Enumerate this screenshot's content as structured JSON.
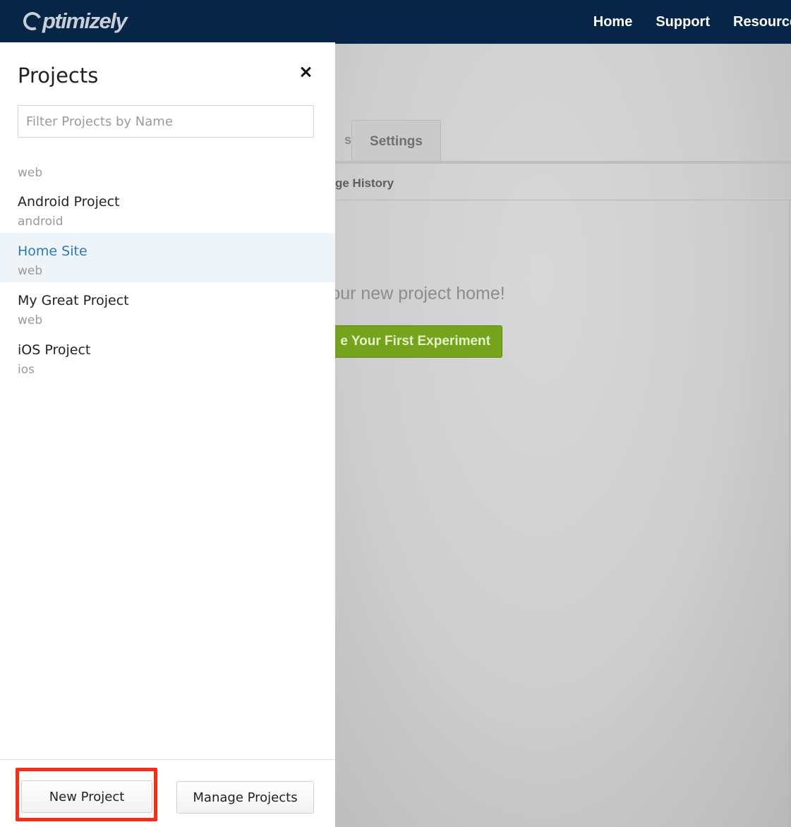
{
  "brand": {
    "logo_text": "ptimizely"
  },
  "top_nav": {
    "items": [
      "Home",
      "Support",
      "Resources"
    ]
  },
  "background_page": {
    "tab_partial": "s",
    "tab_settings": "Settings",
    "subnav_text": "ge History",
    "welcome_text": "o your new project home!",
    "first_experiment_button": "e Your First Experiment"
  },
  "drawer": {
    "title": "Projects",
    "filter_placeholder": "Filter Projects by Name",
    "projects": [
      {
        "name": "",
        "type": "web"
      },
      {
        "name": "Android Project",
        "type": "android"
      },
      {
        "name": "Home Site",
        "type": "web",
        "active": true
      },
      {
        "name": "My Great Project",
        "type": "web"
      },
      {
        "name": "iOS Project",
        "type": "ios"
      }
    ],
    "new_project_label": "New Project",
    "manage_projects_label": "Manage Projects"
  },
  "colors": {
    "topbar": "#072547",
    "active_project_text": "#2a7ab8",
    "active_project_bg": "#eff4f9",
    "cta_green": "#76a31c",
    "highlight_red": "#f0301c"
  }
}
